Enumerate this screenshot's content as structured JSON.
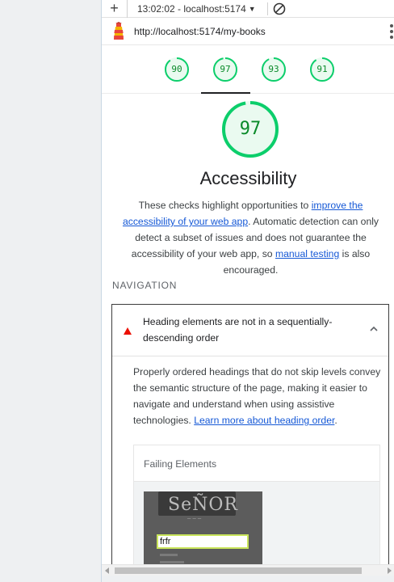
{
  "toolbar": {
    "report_label": "13:02:02 - localhost:5174",
    "add_icon": "plus-icon",
    "block_icon": "block-icon"
  },
  "urlbar": {
    "url": "http://localhost:5174/my-books"
  },
  "scores": [
    {
      "label": "90",
      "fraction": 0.9
    },
    {
      "label": "97",
      "fraction": 0.97
    },
    {
      "label": "93",
      "fraction": 0.93
    },
    {
      "label": "91",
      "fraction": 0.91
    }
  ],
  "category": {
    "score": "97",
    "score_fraction": 0.97,
    "title": "Accessibility",
    "desc_1": "These checks highlight opportunities to ",
    "desc_link_1": "improve the accessibility of your web app",
    "desc_2": ". Automatic detection can only detect a subset of issues and does not guarantee the accessibility of your web app, so ",
    "desc_link_2": "manual testing",
    "desc_3": " is also encouraged."
  },
  "group": {
    "title": "NAVIGATION"
  },
  "audit": {
    "title": "Heading elements are not in a sequentially-descending order",
    "body": "Properly ordered headings that do not skip levels convey the semantic structure of the page, making it easier to navigate and understand when using assistive technologies. ",
    "link": "Learn more about heading order",
    "body_end": ".",
    "details_header": "Failing Elements",
    "thumb_text": "SeÑOR",
    "thumb_input": "frfr"
  },
  "colors": {
    "pass": "#0cce6b",
    "pass_text": "#0a8a2a",
    "fail": "#eb0f00",
    "link": "#1558d6"
  }
}
